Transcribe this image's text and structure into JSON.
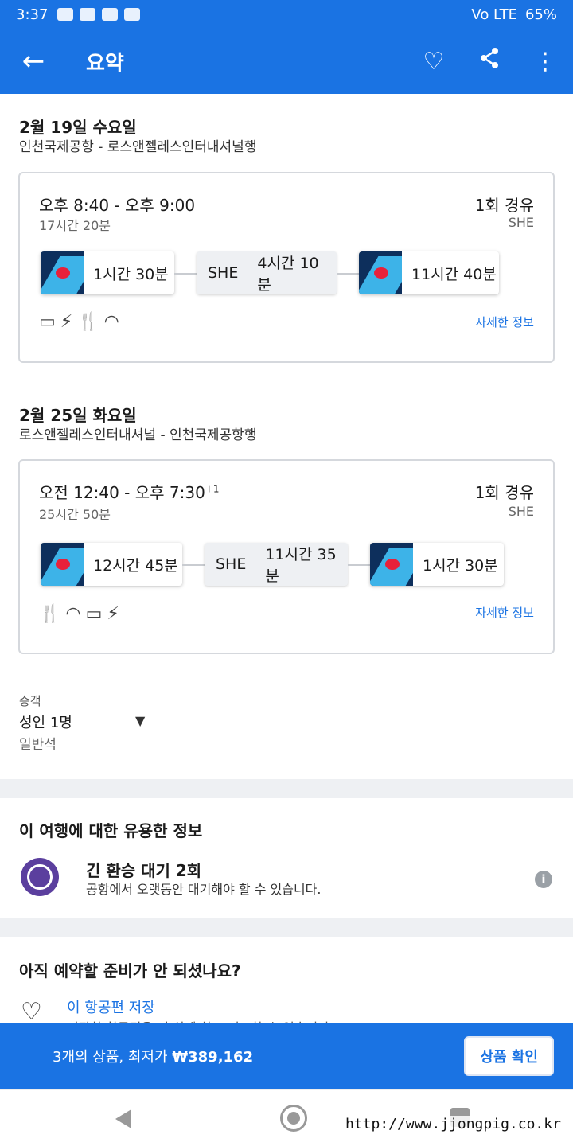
{
  "status_bar": {
    "time": "3:37",
    "battery": "65%",
    "network": "Vo LTE"
  },
  "app_bar": {
    "back_icon": "←",
    "title": "요약",
    "heart_icon": "♡",
    "share_icon": "⋖",
    "more_icon": "⋮"
  },
  "outbound": {
    "date": "2월 19일 수요일",
    "route": "인천국제공항 - 로스앤젤레스인터내셔널행",
    "times": "오후 8:40 - 오후 9:00",
    "duration": "17시간 20분",
    "stops": "1회 경유",
    "stop_code": "SHE",
    "seg1": "1시간 30분",
    "layover_code": "SHE",
    "layover_dur": "4시간 10분",
    "seg2": "11시간 40분",
    "details": "자세한 정보"
  },
  "inbound": {
    "date": "2월 25일 화요일",
    "route": "로스앤젤레스인터내셔널 - 인천국제공항행",
    "times": "오전 12:40 - 오후 7:30",
    "plus_day": "+1",
    "duration": "25시간 50분",
    "stops": "1회 경유",
    "stop_code": "SHE",
    "seg1": "12시간 45분",
    "layover_code": "SHE",
    "layover_dur": "11시간 35분",
    "seg2": "1시간 30분",
    "details": "자세한 정보"
  },
  "passengers": {
    "label": "승객",
    "value": "성인 1명",
    "cabin": "일반석"
  },
  "useful_info": {
    "heading": "이 여행에 대한 유용한 정보",
    "title": "긴 환승 대기 2회",
    "subtitle": "공항에서 오랫동안 대기해야 할 수 있습니다."
  },
  "not_ready": {
    "heading": "아직 예약할 준비가 안 되셨나요?",
    "save_label": "이 항공편 저장",
    "save_sub": "저장한 항공편을 더 쉽게 찾고 비교할 수 있습니다."
  },
  "bottom_bar": {
    "summary_prefix": "3개의 상품, 최저가 ",
    "price": "₩389,162",
    "confirm": "상품 확인"
  },
  "watermark": "http://www.jjongpig.co.kr"
}
